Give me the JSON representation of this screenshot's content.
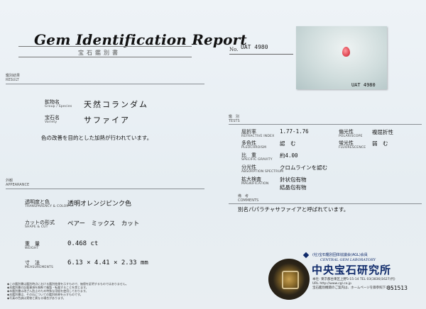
{
  "header": {
    "title": "Gem Identification Report",
    "subtitle": "宝石鑑別書",
    "no_label": "No.",
    "report_no": "UAT 4980"
  },
  "photo": {
    "id_label": "UAT 4980"
  },
  "results": {
    "heading_jp": "鑑別結果",
    "heading_en": "RESULT",
    "species_label_jp": "鉱物名",
    "species_label_en": "Group / Species",
    "species_value": "天然コランダム",
    "variety_label_jp": "宝石名",
    "variety_label_en": "Variety",
    "variety_value": "サファイア",
    "treatment_note": "色の改善を目的とした加熱が行われています。"
  },
  "appearance": {
    "heading_jp": "外観",
    "heading_en": "APPEARANCE",
    "rows": [
      {
        "label_jp": "透明度と色",
        "label_en": "TRANSPARENCY & COLOR",
        "value": "透明オレンジピンク色"
      },
      {
        "label_jp": "カットの形式",
        "label_en": "SHAPE & CUT",
        "value": "ペアー　ミックス　カット"
      },
      {
        "label_jp": "重　量",
        "label_en": "WEIGHT",
        "value": "0.468 ct"
      },
      {
        "label_jp": "寸　法",
        "label_en": "MEASUREMENTS",
        "value": "6.13 × 4.41 × 2.33 mm"
      }
    ]
  },
  "tests": {
    "heading_jp": "鑑　別",
    "heading_en": "TESTS",
    "left_rows": [
      {
        "label_jp": "屈折率",
        "label_en": "REFRACTIVE INDEX",
        "value": "1.77-1.76"
      },
      {
        "label_jp": "多色性",
        "label_en": "PLEOCHROISM",
        "value": "認　む"
      },
      {
        "label_jp": "比　重",
        "label_en": "SPECIFIC GRAVITY",
        "value": "約4.00"
      },
      {
        "label_jp": "分光性",
        "label_en": "ABSORPTION SPECTRUM",
        "value": "クロムラインを認む"
      },
      {
        "label_jp": "拡大検査",
        "label_en": "MAGNIFICATION",
        "value": "針状包有物"
      }
    ],
    "magnification_extra": "結晶包有物",
    "right_rows": [
      {
        "label_jp": "偏光性",
        "label_en": "POLARISCOPE",
        "value": "複屈折性"
      },
      {
        "label_jp": "蛍光性",
        "label_en": "FLUORESCENCE",
        "value": "弱　む"
      }
    ]
  },
  "remarks": {
    "heading_jp": "備　考",
    "heading_en": "COMMENTS",
    "text": "別名パパラチャサファイアと呼ばれています。"
  },
  "lab": {
    "top_line": "(社)宝石鑑別団体協議会(AGL)会員",
    "en_name": "CENTRAL GEM LABORATORY",
    "jp_name": "中央宝石研究所",
    "address_1": "本社: 東京都台東区上野5-15-14 TEL 03(3836)1627(代)",
    "url": "URL http://www.cgl.co.jp",
    "address_2": "宝石鑑別機関のご案内は、ホームページを御参照下さい。",
    "serial": "051513"
  },
  "footnotes": [
    "◆この鑑別書は鑑別時点における鑑別結果を示すもので、価値を証明するものではありません。",
    "◆本鑑別書の記載事項を無断で複製・転載することを禁じます。",
    "◆本鑑別書は改ざん防止のため特殊な用紙を使用しております。",
    "◆本鑑別書は、その石についての鑑別結果を示すものです。",
    "◆写真の色調は実物と異なる場合があります。"
  ]
}
